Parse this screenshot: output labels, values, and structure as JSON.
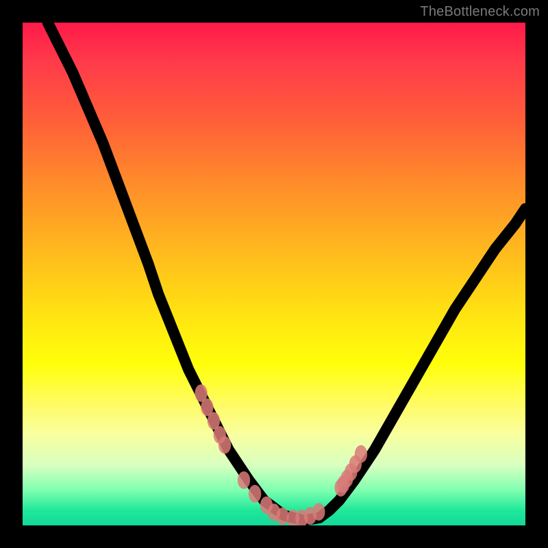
{
  "watermark": "TheBottleneck.com",
  "colors": {
    "frame": "#000000",
    "marker": "#d97a78",
    "gradient_top": "#ff1a4a",
    "gradient_bottom": "#12d99a",
    "curve_stroke": "#000000"
  },
  "chart_data": {
    "type": "line",
    "title": "",
    "xlabel": "",
    "ylabel": "",
    "xlim": [
      0,
      100
    ],
    "ylim": [
      0,
      100
    ],
    "grid": false,
    "legend": false,
    "note": "No numeric axis ticks or labels are rendered in the image; values are read from pixel positions normalized to a 0–100 viewbox. y=0 is bottom.",
    "series": [
      {
        "name": "curve",
        "type": "line",
        "x": [
          5,
          7,
          10,
          13,
          16,
          19,
          22,
          25,
          27,
          29,
          31,
          33,
          35,
          37,
          39,
          41,
          43,
          45,
          48,
          52,
          56,
          59,
          61,
          63,
          66,
          70,
          74,
          78,
          82,
          86,
          90,
          94,
          98,
          100
        ],
        "y": [
          100,
          96,
          90,
          83,
          76,
          68,
          60,
          52,
          46,
          41,
          36,
          31,
          27,
          23,
          19,
          15,
          12,
          9,
          5,
          2,
          1,
          1.5,
          3,
          5,
          9,
          15,
          22,
          29,
          36,
          43,
          49,
          55,
          60,
          63
        ]
      },
      {
        "name": "markers",
        "type": "scatter",
        "x": [
          35.5,
          36.7,
          38.0,
          39.2,
          40.2,
          44.0,
          46.2,
          48.5,
          50.0,
          51.7,
          53.8,
          55.5,
          57.2,
          58.9,
          63.3,
          63.8,
          64.5,
          65.3,
          66.2,
          67.3
        ],
        "y": [
          26.3,
          23.5,
          20.8,
          18.0,
          16.0,
          9.0,
          6.3,
          4.0,
          2.6,
          1.8,
          1.4,
          1.4,
          1.9,
          2.7,
          7.5,
          8.2,
          9.3,
          10.6,
          12.2,
          14.2
        ]
      }
    ]
  }
}
